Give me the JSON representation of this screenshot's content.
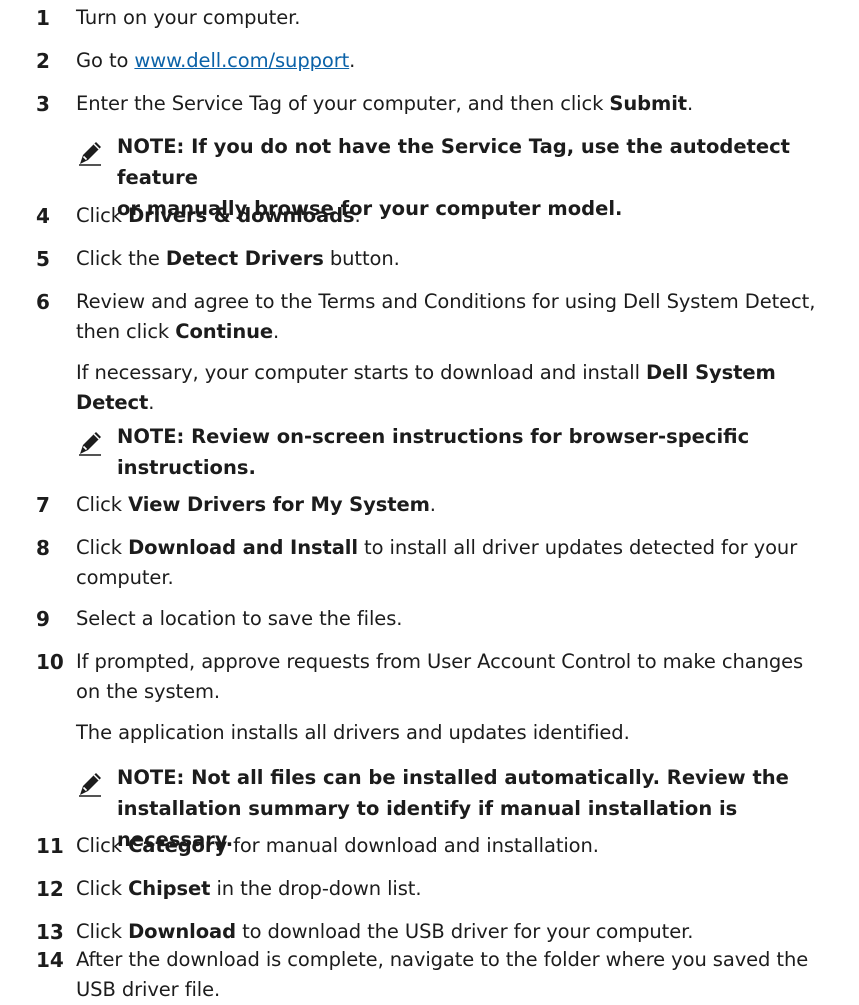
{
  "steps": [
    {
      "num": "1",
      "parts": [
        "Turn on your computer."
      ]
    },
    {
      "num": "2",
      "pre": "Go to ",
      "link": "www.dell.com/support",
      "post": "."
    },
    {
      "num": "3",
      "parts": [
        "Enter the Service Tag of your computer, and then click ",
        "Submit",
        "."
      ]
    },
    {
      "num": "4",
      "parts": [
        "Click ",
        "Drivers & downloads",
        "."
      ]
    },
    {
      "num": "5",
      "parts": [
        "Click the ",
        "Detect Drivers",
        " button."
      ]
    },
    {
      "num": "6",
      "parts": [
        "Review and agree to the Terms and Conditions for using Dell System Detect,",
        "then click ",
        "Continue",
        "."
      ]
    },
    {
      "num": "7",
      "parts": [
        "Click ",
        "View Drivers for My System",
        "."
      ]
    },
    {
      "num": "8",
      "parts": [
        "Click ",
        "Download and Install",
        " to install all driver updates detected for your",
        "computer."
      ]
    },
    {
      "num": "9",
      "parts": [
        "Select a location to save the files."
      ]
    },
    {
      "num": "10",
      "parts": [
        "If prompted, approve requests from User Account Control to make changes",
        "on the system."
      ]
    },
    {
      "num": "11",
      "parts": [
        "Click ",
        "Category",
        " for manual download and installation."
      ]
    },
    {
      "num": "12",
      "parts": [
        "Click ",
        "Chipset",
        " in the drop-down list."
      ]
    },
    {
      "num": "13",
      "parts": [
        "Click ",
        "Download",
        " to download the USB driver for your computer."
      ]
    },
    {
      "num": "14",
      "parts": [
        "After the download is complete, navigate to the folder where you saved the",
        "USB driver file."
      ]
    }
  ],
  "paras": {
    "p6": [
      "If necessary, your computer starts to download and install ",
      "Dell System",
      "Detect",
      "."
    ],
    "p10": "The application installs all drivers and updates identified."
  },
  "notes": {
    "n3": [
      "NOTE: If you do not have the Service Tag, use the autodetect feature",
      "or manually browse for your computer model."
    ],
    "n6": [
      "NOTE: Review on-screen instructions for browser-specific",
      "instructions."
    ],
    "n10": [
      "NOTE: Not all files can be installed automatically. Review the",
      "installation summary to identify if manual installation is necessary."
    ]
  },
  "icons": {
    "note": "pencil-note-icon"
  },
  "colors": {
    "text": "#1c1c1c",
    "link": "#0b62a8"
  }
}
